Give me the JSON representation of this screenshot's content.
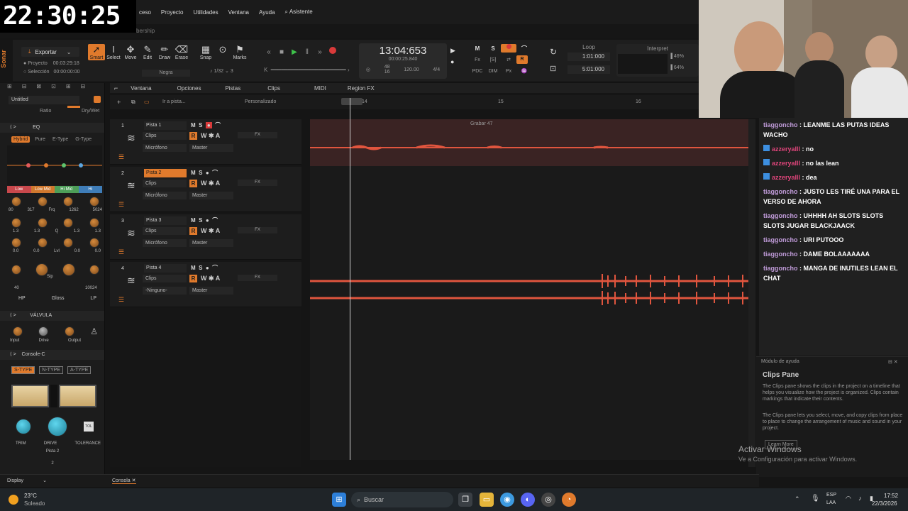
{
  "overlay_clock": "22:30:25",
  "menu": [
    "ceso",
    "Proyecto",
    "Utilidades",
    "Ventana",
    "Ayuda",
    "Asistente"
  ],
  "subbar_text": "bership",
  "app_name": "Sonar",
  "export": {
    "label": "Exportar",
    "project_label": "Proyecto",
    "project_time": "00:03:29:18",
    "selection_label": "Selección",
    "selection_time": "00:00:00:00"
  },
  "tools": [
    "Smart",
    "Select",
    "Move",
    "Edit",
    "Draw",
    "Erase",
    "Snap",
    "Marks"
  ],
  "snap": {
    "value": "1/32",
    "beats": "3",
    "style": "Negra"
  },
  "transport": {
    "time": "13:04:653",
    "sub_time": "00:00:25.840",
    "tempo": "120.00",
    "meter": "4/4",
    "val48": "48",
    "val16": "16"
  },
  "loop": {
    "label": "Loop",
    "start": "1:01:000",
    "end": "5:01:000"
  },
  "interpret": {
    "label": "Interpret",
    "v1": "46%",
    "v2": "64%"
  },
  "inspector": {
    "preset": "Untitled",
    "ratio_label": "Ratio",
    "drywet_label": "Dry/Wet",
    "eq_title": "EQ",
    "eq_modes": [
      "Hybrid",
      "Pure",
      "E-Type",
      "G-Type"
    ],
    "eq_bands": [
      "Low",
      "Low Mid",
      "Hi Mid",
      "Hi"
    ],
    "freq_row": [
      "80",
      "317",
      "1262",
      "5024"
    ],
    "frq_label": "Frq",
    "q_row": [
      "1.3",
      "1.3",
      "1.3",
      "1.3"
    ],
    "q_label": "Q",
    "lvl_row": [
      "0.0",
      "0.0",
      "0.0",
      "0.0"
    ],
    "lvl_label": "Lvl",
    "slp_label": "Slp",
    "hp_val": "40",
    "lp_val": "10024",
    "filters": [
      "HP",
      "Gloss",
      "LP"
    ],
    "valvula_title": "VÁLVULA",
    "valvula_knobs": [
      "Input",
      "Drive",
      "Output"
    ],
    "console_title": "Console-C",
    "console_types": [
      "S-TYPE",
      "N-TYPE",
      "A-TYPE"
    ],
    "console_knobs": [
      "TRIM",
      "DRIVE",
      "TOLERANCE"
    ],
    "tol_label": "TOL",
    "track_name": "Pista 2",
    "track_num": "2"
  },
  "trackbar": [
    "Ventana",
    "Opciones",
    "Pistas",
    "Clips",
    "MIDI",
    "Region FX"
  ],
  "track_top": {
    "goto": "Ir a pista...",
    "custom": "Personalizado",
    "ruler": [
      "14",
      "15",
      "16"
    ]
  },
  "tracks": [
    {
      "num": "1",
      "name": "Pista 1",
      "clips": "Clips",
      "input": "Micrófono",
      "output": "Master"
    },
    {
      "num": "2",
      "name": "Pista 2",
      "clips": "Clips",
      "input": "Micrófono",
      "output": "Master"
    },
    {
      "num": "3",
      "name": "Pista 3",
      "clips": "Clips",
      "input": "Micrófono",
      "output": "Master"
    },
    {
      "num": "4",
      "name": "Pista 4",
      "clips": "Clips",
      "input": "-Ninguno-",
      "output": "Master"
    }
  ],
  "clip_label": "Grabar 47",
  "chat": [
    {
      "user": "tiaggoncho",
      "msg": "LEANME LAS PUTAS IDEAS WACHO",
      "style": "u1"
    },
    {
      "user": "azzeryalll",
      "msg": "no",
      "style": "u2"
    },
    {
      "user": "azzeryalll",
      "msg": "no las lean",
      "style": "u2"
    },
    {
      "user": "azzeryalll",
      "msg": "dea",
      "style": "u2"
    },
    {
      "user": "tiaggoncho",
      "msg": "JUSTO LES TIRÉ UNA PARA EL VERSO DE AHORA",
      "style": "u1"
    },
    {
      "user": "tiaggoncho",
      "msg": "UHHHH AH SLOTS SLOTS SLOTS JUGAR BLACKJAACK",
      "style": "u1"
    },
    {
      "user": "tiaggoncho",
      "msg": "URI PUTOOO",
      "style": "u1"
    },
    {
      "user": "tiaggoncho",
      "msg": "DAME BOLAAAAAAA",
      "style": "u1"
    },
    {
      "user": "tiaggoncho",
      "msg": "MANGA DE INUTILES LEAN EL CHAT",
      "style": "u1"
    }
  ],
  "help": {
    "header": "Módulo de ayuda",
    "title": "Clips Pane",
    "p1": "The Clips pane shows the clips in the project on a timeline that helps you visualize how the project is organized. Clips contain markings that indicate their contents.",
    "p2": "The Clips pane lets you select, move, and copy clips from place to place to change the arrangement of music and sound in your project.",
    "learn_more": "Learn More"
  },
  "activate": {
    "title": "Activar Windows",
    "sub": "Ve a Configuración para activar Windows."
  },
  "status": {
    "display": "Display",
    "console": "Consola"
  },
  "taskbar": {
    "weather_temp": "23°C",
    "weather_text": "Soleado",
    "search": "Buscar",
    "lang1": "ESP",
    "lang2": "LAA",
    "time": "17:52",
    "date": "22/3/2026"
  }
}
